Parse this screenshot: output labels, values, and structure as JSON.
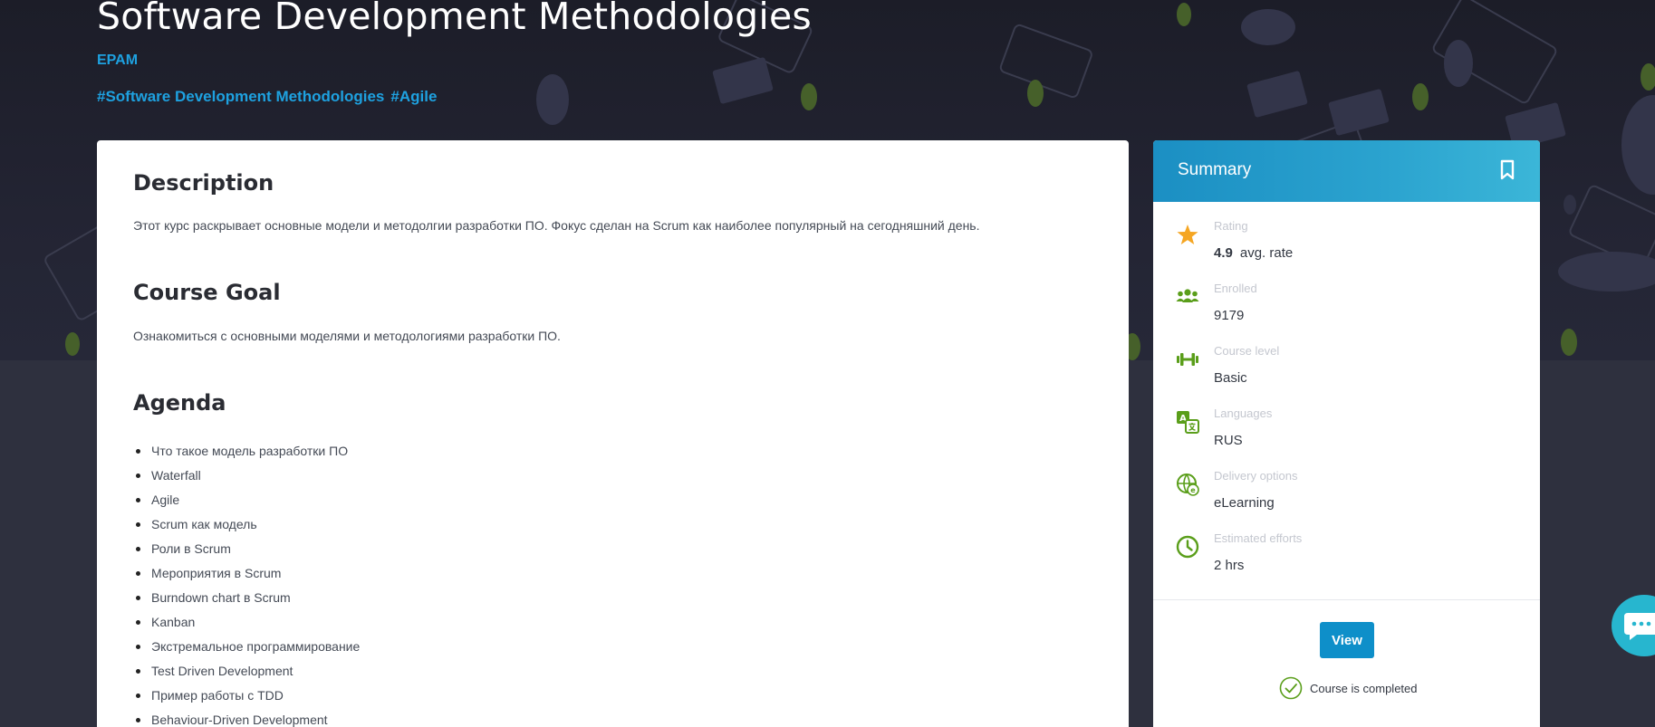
{
  "course": {
    "title": "Software Development Methodologies",
    "provider": "EPAM",
    "tags": [
      "#Software Development Methodologies",
      "#Agile"
    ]
  },
  "main": {
    "description_heading": "Description",
    "description_text": "Этот курс раскрывает основные модели и методолгии разработки ПО. Фокус сделан на Scrum как наиболее популярный на сегодняшний день.",
    "goal_heading": "Course Goal",
    "goal_text": "Ознакомиться с основными моделями и методологиями разработки ПО.",
    "agenda_heading": "Agenda",
    "agenda_items": [
      "Что такое модель разработки ПО",
      "Waterfall",
      "Agile",
      "Scrum как модель",
      "Роли в Scrum",
      "Мероприятия в Scrum",
      "Burndown chart в Scrum",
      "Kanban",
      "Экстремальное программирование",
      "Test Driven Development",
      "Пример работы с TDD",
      "Behaviour-Driven Development"
    ]
  },
  "summary": {
    "title": "Summary",
    "rating_label": "Rating",
    "rating_value": "4.9",
    "rating_suffix": "avg. rate",
    "enrolled_label": "Enrolled",
    "enrolled_value": "9179",
    "level_label": "Course level",
    "level_value": "Basic",
    "languages_label": "Languages",
    "languages_value": "RUS",
    "delivery_label": "Delivery options",
    "delivery_value": "eLearning",
    "efforts_label": "Estimated efforts",
    "efforts_value": "2 hrs",
    "view_button": "View",
    "completed_text": "Course is completed"
  },
  "colors": {
    "accent_blue": "#1ea1e0",
    "button_blue": "#0e8fc9",
    "icon_green": "#5a9e1a",
    "star_orange": "#f5a623"
  },
  "icons": [
    "bookmark-icon",
    "star-icon",
    "people-icon",
    "dumbbell-icon",
    "translate-icon",
    "globe-icon",
    "clock-icon",
    "check-circle-icon",
    "chat-icon"
  ]
}
